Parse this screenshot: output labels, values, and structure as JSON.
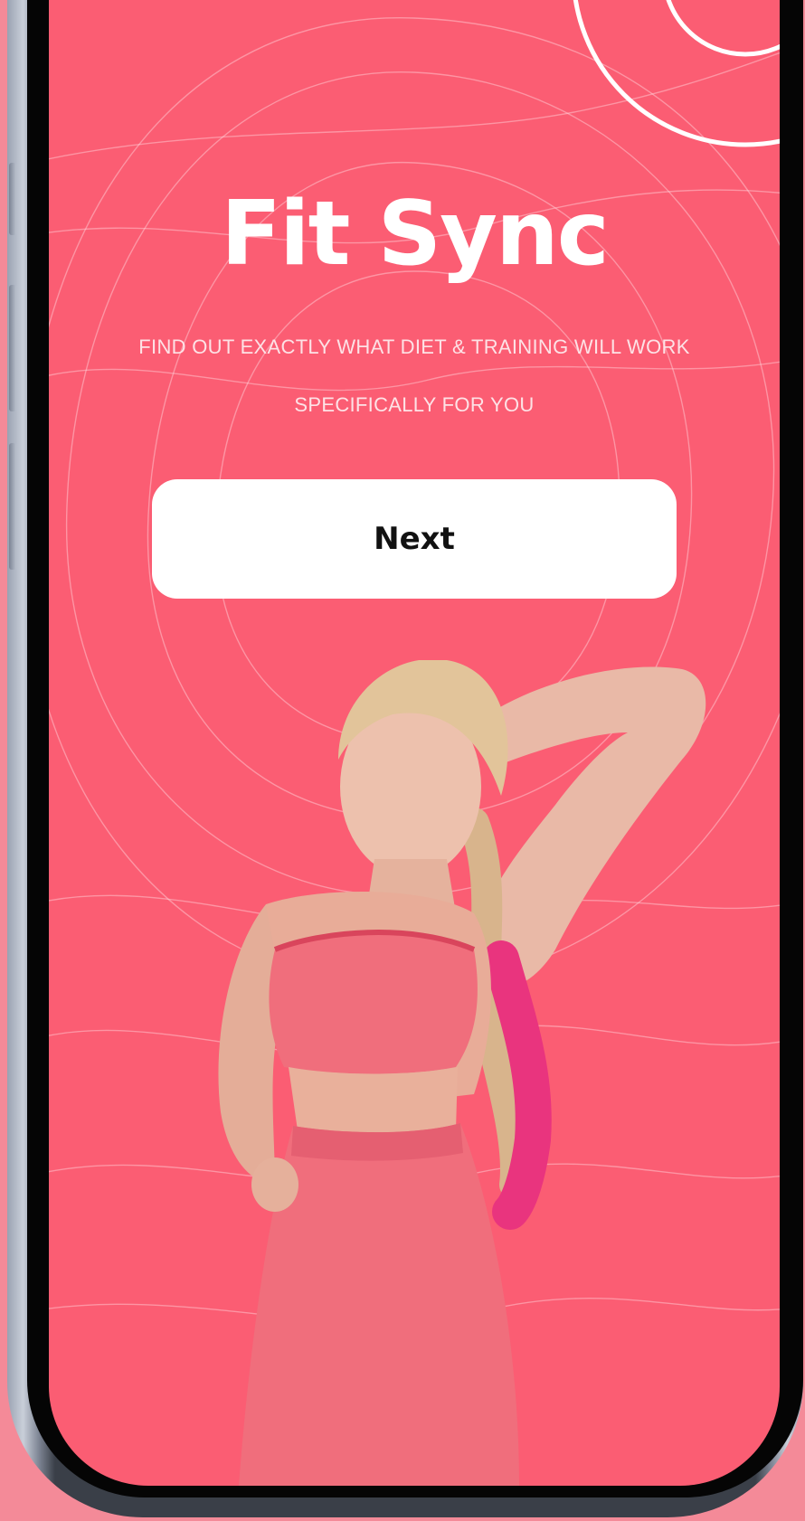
{
  "app": {
    "title": "Fit Sync",
    "tagline": "FIND OUT EXACTLY WHAT DIET & TRAINING WILL WORK SPECIFICALLY FOR YOU"
  },
  "actions": {
    "next_label": "Next"
  },
  "hero": {
    "image": "woman-in-pink-sportswear-photo"
  },
  "colors": {
    "screen_background": "#fb5d73",
    "outer_background": "#f48a98",
    "button_background": "#ffffff",
    "button_text": "#111111",
    "title_text": "#ffffff",
    "outfit": "#f06e7c",
    "hair_accent": "#e9347e"
  }
}
